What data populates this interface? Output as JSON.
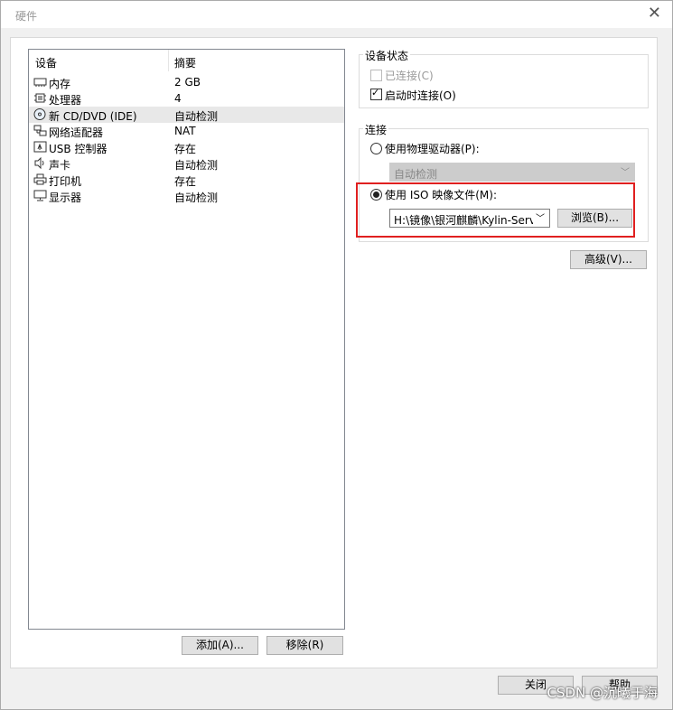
{
  "window": {
    "title": "硬件",
    "close_icon": "close-icon"
  },
  "device_list": {
    "headers": {
      "device": "设备",
      "summary": "摘要"
    },
    "rows": [
      {
        "name": "内存",
        "summary": "2 GB",
        "icon": "memory-icon"
      },
      {
        "name": "处理器",
        "summary": "4",
        "icon": "cpu-icon"
      },
      {
        "name": "新 CD/DVD (IDE)",
        "summary": "自动检测",
        "icon": "cd-icon",
        "selected": true
      },
      {
        "name": "网络适配器",
        "summary": "NAT",
        "icon": "network-icon"
      },
      {
        "name": "USB 控制器",
        "summary": "存在",
        "icon": "usb-icon"
      },
      {
        "name": "声卡",
        "summary": "自动检测",
        "icon": "speaker-icon"
      },
      {
        "name": "打印机",
        "summary": "存在",
        "icon": "printer-icon"
      },
      {
        "name": "显示器",
        "summary": "自动检测",
        "icon": "monitor-icon"
      }
    ],
    "add_button": "添加(A)...",
    "remove_button": "移除(R)"
  },
  "device_status": {
    "label": "设备状态",
    "connected": {
      "label": "已连接(C)",
      "checked": false,
      "disabled": true
    },
    "connect_at_power_on": {
      "label": "启动时连接(O)",
      "checked": true
    }
  },
  "connection": {
    "label": "连接",
    "physical_drive": {
      "label": "使用物理驱动器(P):",
      "selected": false
    },
    "physical_drive_value": "自动检测",
    "iso_image": {
      "label": "使用 ISO 映像文件(M):",
      "selected": true
    },
    "iso_path": "H:\\镜像\\银河麒麟\\Kylin-Server",
    "browse_button": "浏览(B)..."
  },
  "advanced_button": "高级(V)...",
  "footer": {
    "close_button": "关闭",
    "help_button": "帮助"
  },
  "watermark": "CSDN @沉曦于海",
  "colors": {
    "highlight_box": "#e02020",
    "selected_row": "#e8e8e8"
  }
}
